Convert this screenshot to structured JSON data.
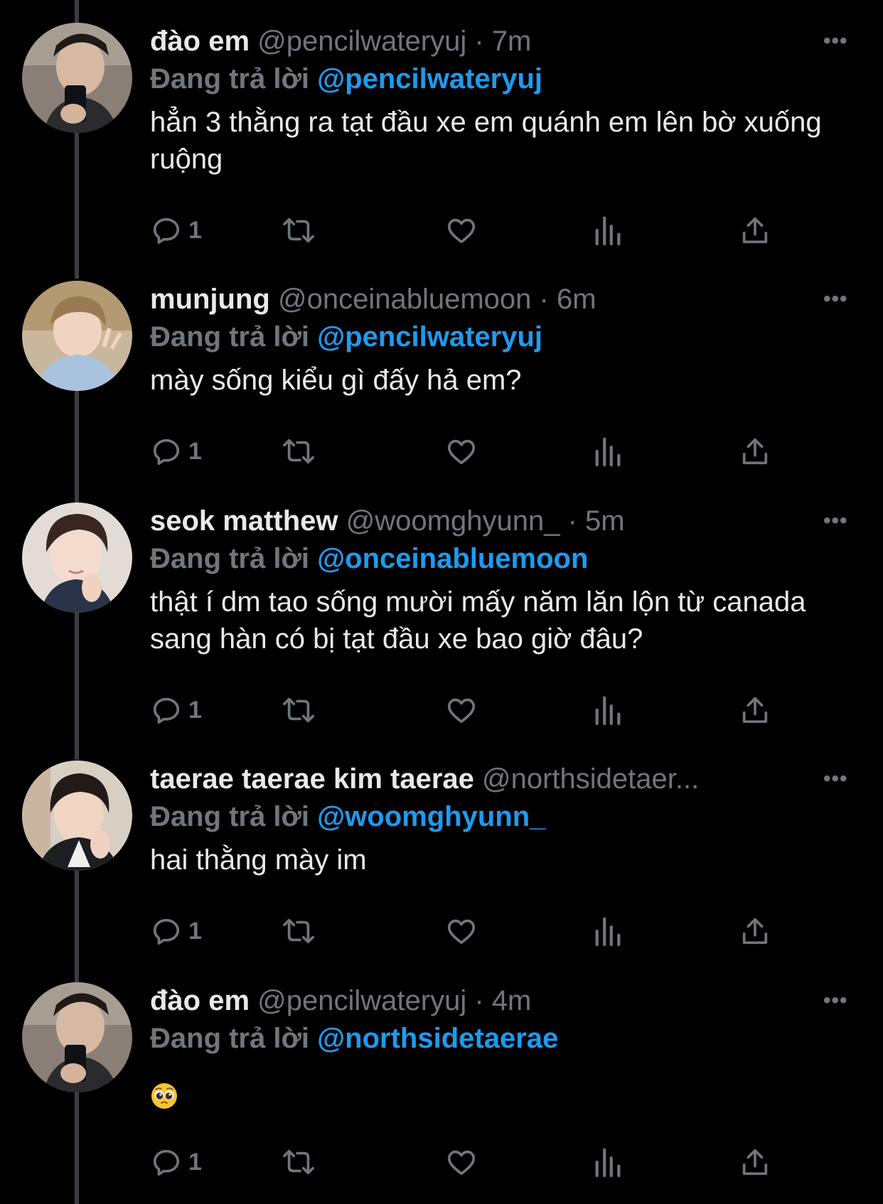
{
  "colors": {
    "background": "#000000",
    "text": "#e7e9ea",
    "muted": "#71767b",
    "accent": "#1d9bf0",
    "thread_line": "#3a3d41"
  },
  "icons": [
    "reply-icon",
    "retweet-icon",
    "like-icon",
    "views-icon",
    "share-icon",
    "more-icon"
  ],
  "tweets": [
    {
      "display_name": "đào em",
      "handle": "@pencilwateryuj",
      "separator": "·",
      "time": "7m",
      "reply_label": "Đang trả lời",
      "reply_to": "@pencilwateryuj",
      "text": "hẳn 3 thằng ra tạt đầu xe em quánh em lên bờ xuống ruộng",
      "reply_count": "1",
      "more": "•••"
    },
    {
      "display_name": "munjung",
      "handle": "@onceinabluemoon",
      "separator": "·",
      "time": "6m",
      "reply_label": "Đang trả lời",
      "reply_to": "@pencilwateryuj",
      "text": "mày sống kiểu gì đấy hả em?",
      "reply_count": "1",
      "more": "•••"
    },
    {
      "display_name": "seok matthew",
      "handle": "@woomghyunn_",
      "separator": "·",
      "time": "5m",
      "reply_label": "Đang trả lời",
      "reply_to": "@onceinabluemoon",
      "text": "thật í dm tao sống mười mấy năm lăn lộn từ canada sang hàn có bị tạt đầu xe bao giờ đâu?",
      "reply_count": "1",
      "more": "•••"
    },
    {
      "display_name": "taerae taerae kim taerae",
      "handle": "@northsidetaer...",
      "separator": "",
      "time": "",
      "reply_label": "Đang trả lời",
      "reply_to": "@woomghyunn_",
      "text": "hai thằng mày im",
      "reply_count": "1",
      "more": "•••"
    },
    {
      "display_name": "đào em",
      "handle": "@pencilwateryuj",
      "separator": "·",
      "time": "4m",
      "reply_label": "Đang trả lời",
      "reply_to": "@northsidetaerae",
      "text": "",
      "emoji": "pleading-face",
      "reply_count": "1",
      "more": "•••"
    }
  ]
}
